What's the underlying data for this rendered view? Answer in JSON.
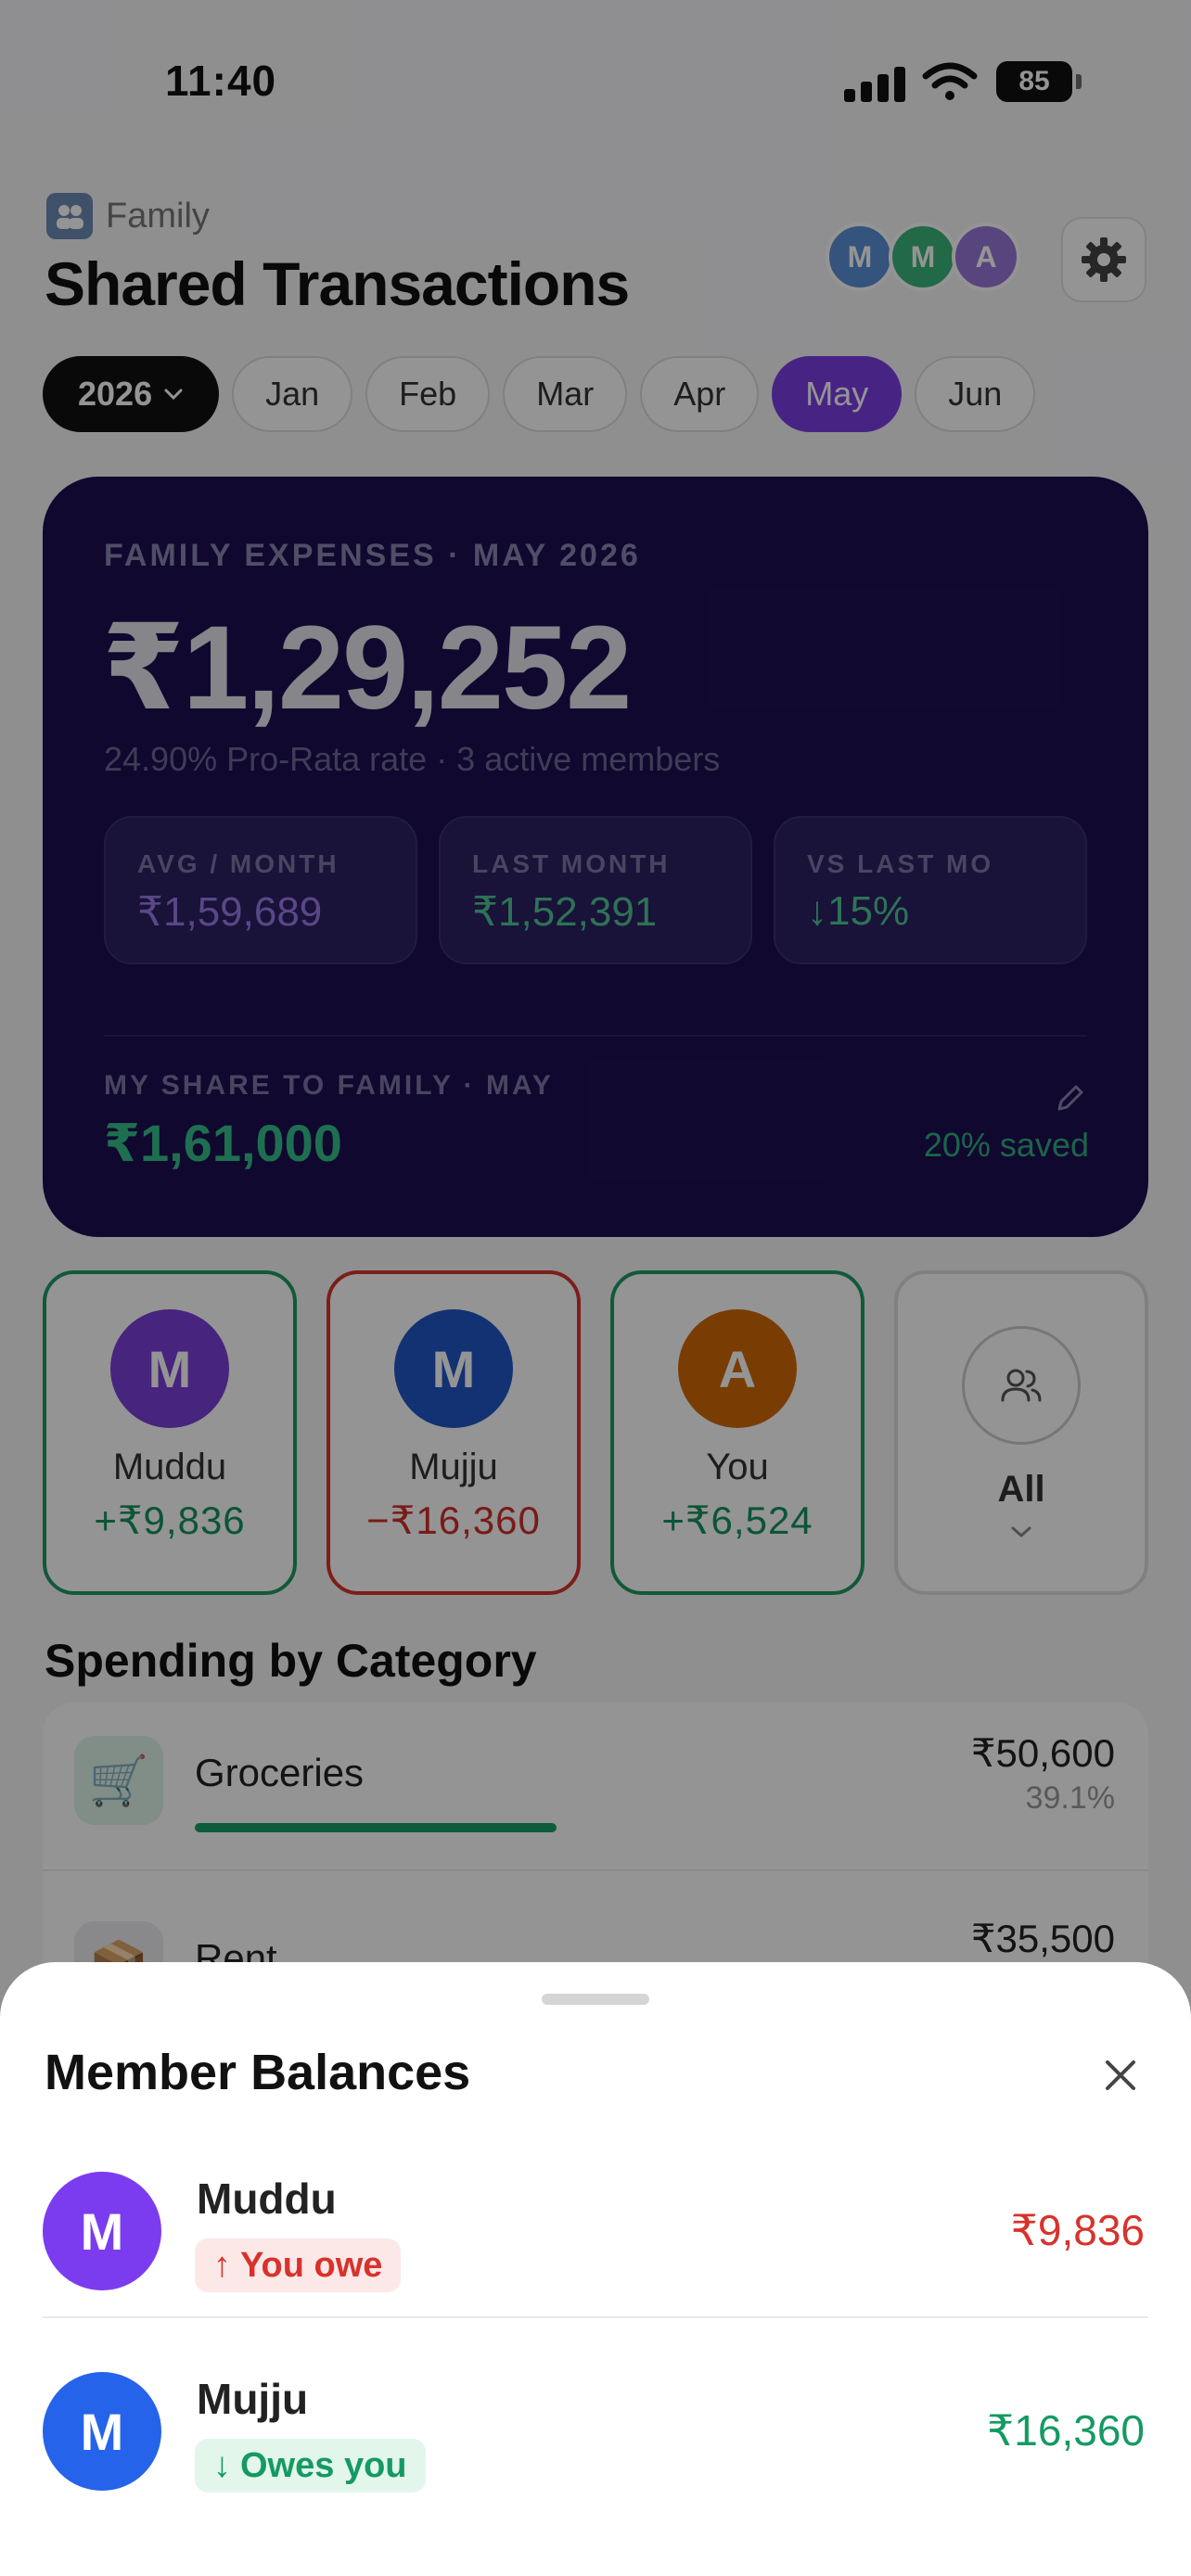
{
  "status": {
    "time": "11:40",
    "battery": "85"
  },
  "header": {
    "family_label": "Family",
    "title": "Shared Transactions",
    "avatars": [
      {
        "letter": "M",
        "color": "#5b8fd8"
      },
      {
        "letter": "M",
        "color": "#3bb57a"
      },
      {
        "letter": "A",
        "color": "#9a78d8"
      }
    ]
  },
  "months": {
    "year": "2026",
    "items": [
      "Jan",
      "Feb",
      "Mar",
      "Apr",
      "May",
      "Jun"
    ],
    "active": "May"
  },
  "summary": {
    "label": "FAMILY EXPENSES · MAY 2026",
    "amount": "₹1,29,252",
    "subtitle": "24.90% Pro-Rata rate · 3 active members",
    "stats": [
      {
        "label": "AVG / MONTH",
        "value": "₹1,59,689",
        "color": "#9b7be8"
      },
      {
        "label": "LAST MONTH",
        "value": "₹1,52,391",
        "color": "#4fc795"
      },
      {
        "label": "VS LAST MO",
        "value": "↓15%",
        "color": "#4fc795"
      }
    ],
    "share_label": "MY SHARE TO FAMILY · MAY",
    "share_value": "₹1,61,000",
    "saved": "20% saved"
  },
  "members": [
    {
      "letter": "M",
      "name": "Muddu",
      "value": "+₹9,836",
      "avatar_color": "#7a3fd8",
      "value_color": "#16935f",
      "border_color": "#1f9a63"
    },
    {
      "letter": "M",
      "name": "Mujju",
      "value": "−₹16,360",
      "avatar_color": "#1f56c8",
      "value_color": "#d0302a",
      "border_color": "#d6342c"
    },
    {
      "letter": "A",
      "name": "You",
      "value": "+₹6,524",
      "avatar_color": "#d06a08",
      "value_color": "#16935f",
      "border_color": "#1f9a63"
    }
  ],
  "all_tile": {
    "label": "All",
    "icon": "users-icon"
  },
  "spending": {
    "title": "Spending by Category",
    "categories": [
      {
        "name": "Groceries",
        "amount": "₹50,600",
        "percent": "39.1%",
        "icon": "🛒",
        "share": 0.391
      },
      {
        "name": "Rent",
        "amount": "₹35,500",
        "percent": "",
        "icon": "📦"
      }
    ]
  },
  "sheet": {
    "title": "Member Balances",
    "rows": [
      {
        "letter": "M",
        "name": "Muddu",
        "badge": "You owe",
        "arrow": "↑",
        "amount": "₹9,836",
        "avatar_color": "#7b3cf0",
        "badge_bg": "#fde8e8",
        "badge_color": "#d8322c",
        "amount_color": "#d8322c"
      },
      {
        "letter": "M",
        "name": "Mujju",
        "badge": "Owes you",
        "arrow": "↓",
        "amount": "₹16,360",
        "avatar_color": "#2563eb",
        "badge_bg": "#e3f6ec",
        "badge_color": "#149a62",
        "amount_color": "#149a62"
      }
    ]
  }
}
